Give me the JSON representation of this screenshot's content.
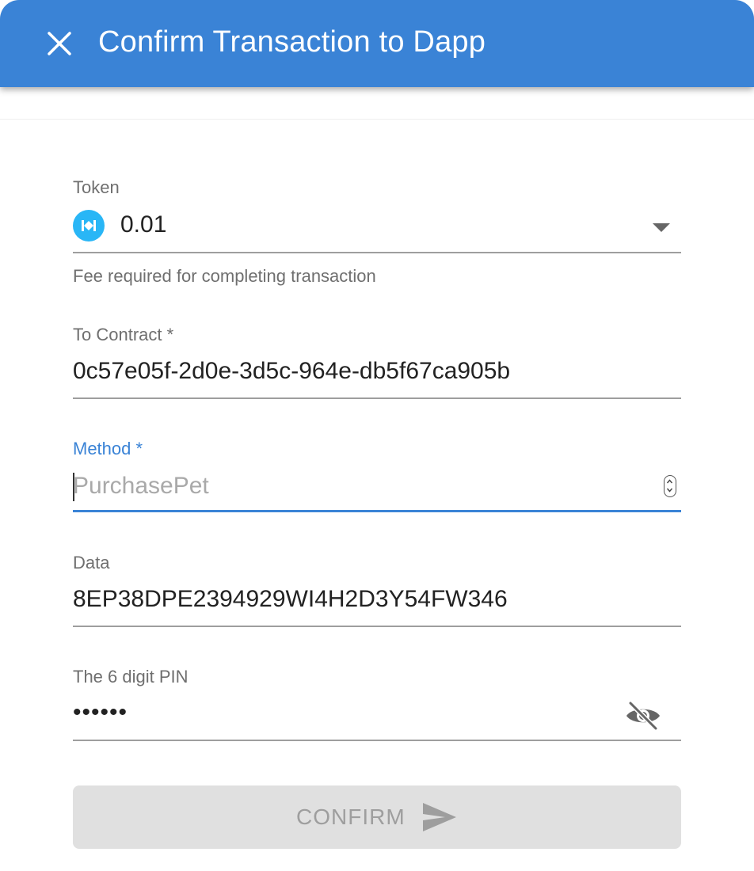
{
  "header": {
    "title": "Confirm Transaction to Dapp"
  },
  "form": {
    "token": {
      "label": "Token",
      "value": "0.01",
      "helper": "Fee required for completing transaction",
      "icon": "token-icon"
    },
    "to_contract": {
      "label": "To Contract *",
      "value": "0c57e05f-2d0e-3d5c-964e-db5f67ca905b"
    },
    "method": {
      "label": "Method *",
      "placeholder": "PurchasePet",
      "value": ""
    },
    "data": {
      "label": "Data",
      "value": "8EP38DPE2394929WI4H2D3Y54FW346"
    },
    "pin": {
      "label": "The 6 digit PIN",
      "masked_value": "••••••"
    }
  },
  "confirm_button": {
    "label": "CONFIRM"
  },
  "colors": {
    "header": "#3a83d6",
    "active": "#3a83d6",
    "token_icon": "#29b6f6",
    "button_disabled_bg": "#e0e0e0",
    "button_disabled_text": "#9e9e9e"
  }
}
